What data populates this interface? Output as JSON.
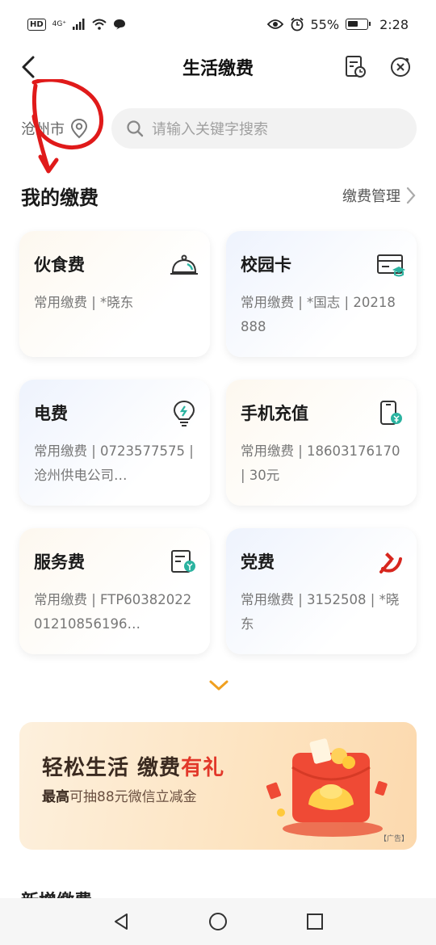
{
  "status_bar": {
    "left_hd": "HD",
    "left_net": "4G⁺",
    "battery": "55%",
    "time": "2:28",
    "icons": [
      "hd-icon",
      "signal-icon",
      "wifi-icon",
      "chat-bubble-icon",
      "eye-icon",
      "alarm-icon",
      "battery-icon"
    ]
  },
  "header": {
    "title": "生活缴费",
    "icons": [
      "back-arrow-icon",
      "bill-history-icon",
      "close-circle-icon"
    ]
  },
  "location": {
    "city": "沧州市"
  },
  "search": {
    "placeholder": "请输入关键字搜索"
  },
  "my_payments": {
    "title": "我的缴费",
    "manage_label": "缴费管理",
    "cards": [
      {
        "title": "伙食费",
        "subtitle": "常用缴费 | *晓东",
        "icon": "meal-cloche-icon",
        "tone": "warm"
      },
      {
        "title": "校园卡",
        "subtitle": "常用缴费 | *国志 | 20218888",
        "icon": "campus-card-icon",
        "tone": "blue"
      },
      {
        "title": "电费",
        "subtitle": "常用缴费 | 0723577575 | 沧州供电公司…",
        "icon": "lightbulb-icon",
        "tone": "blue"
      },
      {
        "title": "手机充值",
        "subtitle": "常用缴费 | 18603176170 | 30元",
        "icon": "phone-topup-icon",
        "tone": "warm"
      },
      {
        "title": "服务费",
        "subtitle": "常用缴费 | FTP6038202201210856196…",
        "icon": "service-bill-icon",
        "tone": "warm"
      },
      {
        "title": "党费",
        "subtitle": "常用缴费 | 3152508 | *晓东",
        "icon": "party-emblem-icon",
        "tone": "blue"
      }
    ]
  },
  "banner": {
    "title_part1": "轻松生活 缴费",
    "title_highlight": "有礼",
    "subtitle_bold": "最高",
    "subtitle_rest": "可抽88元微信立减金",
    "ad_tag": "【广告】"
  },
  "next_section": {
    "title": "新增缴费"
  },
  "colors": {
    "accent_orange": "#f0a020",
    "red": "#e2382a",
    "teal": "#2bb3a0",
    "text_dark": "#1a1a1a",
    "text_gray": "#777777"
  }
}
